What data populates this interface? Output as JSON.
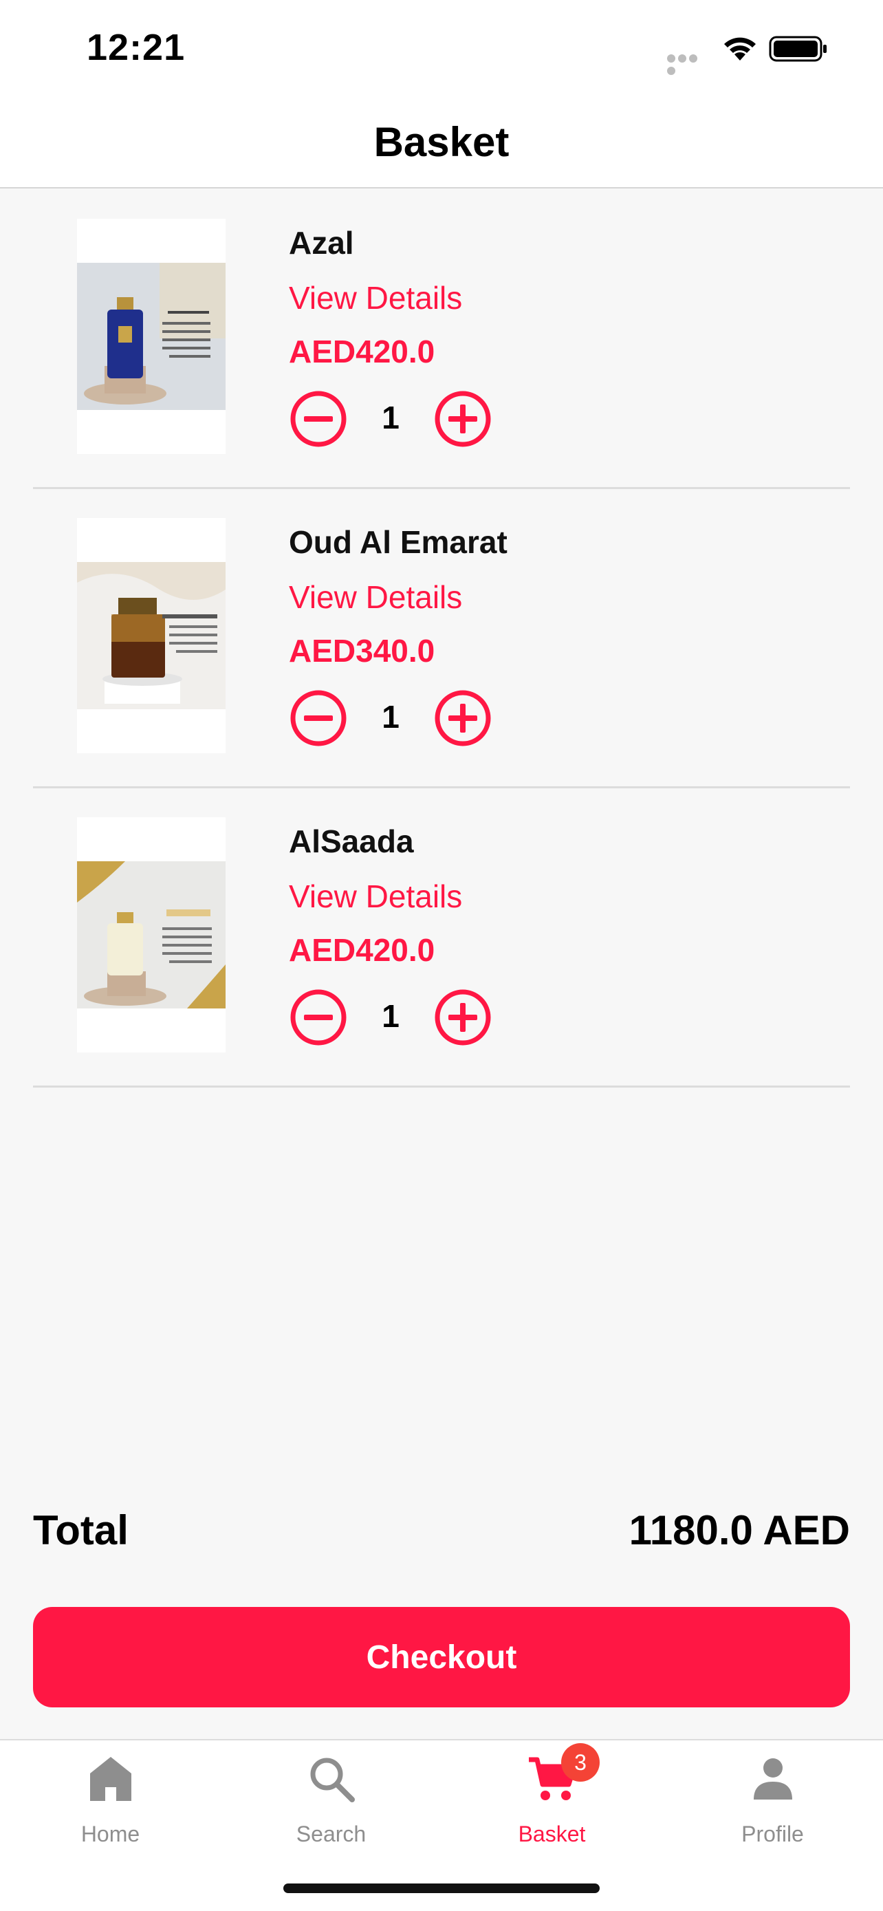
{
  "status_bar": {
    "time": "12:21"
  },
  "nav": {
    "title": "Basket"
  },
  "cart": {
    "items": [
      {
        "name": "Azal",
        "view_details": "View Details",
        "price": "AED420.0",
        "quantity": "1"
      },
      {
        "name": "Oud Al Emarat",
        "view_details": "View Details",
        "price": "AED340.0",
        "quantity": "1"
      },
      {
        "name": "AlSaada",
        "view_details": "View Details",
        "price": "AED420.0",
        "quantity": "1"
      }
    ]
  },
  "summary": {
    "total_label": "Total",
    "total_value": "1180.0 AED"
  },
  "checkout": {
    "label": "Checkout"
  },
  "tabs": {
    "items": [
      {
        "label": "Home",
        "icon": "home-icon"
      },
      {
        "label": "Search",
        "icon": "search-icon"
      },
      {
        "label": "Basket",
        "icon": "cart-icon"
      },
      {
        "label": "Profile",
        "icon": "profile-icon"
      }
    ],
    "active": "Basket",
    "basket_badge": "3"
  },
  "colors": {
    "accent": "#ff1744",
    "badge": "#f44336",
    "inactive": "#8e8e8e",
    "background": "#f7f7f7"
  }
}
